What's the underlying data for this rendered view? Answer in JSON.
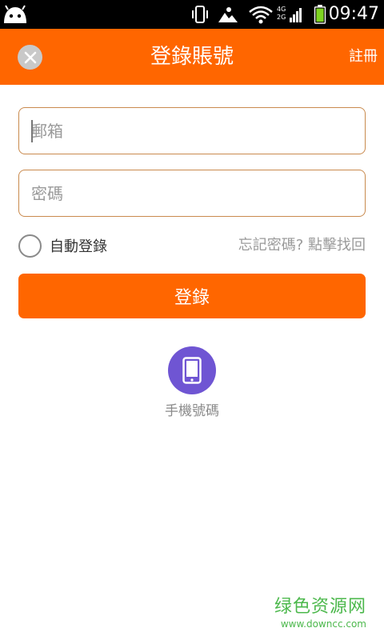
{
  "status_bar": {
    "time": "09:47",
    "network_top": "4G",
    "network_bottom": "2G"
  },
  "header": {
    "title": "登錄賬號",
    "register_label": "註冊"
  },
  "form": {
    "email_placeholder": "郵箱",
    "password_placeholder": "密碼",
    "auto_login_label": "自動登錄",
    "forgot_password_label": "忘記密碼? 點擊找回",
    "login_button_label": "登錄"
  },
  "alt_login": {
    "phone_label": "手機號碼"
  },
  "watermark": {
    "text": "绿色资源网",
    "url": "www.downcc.com"
  },
  "colors": {
    "accent": "#ff6600",
    "phone_icon_bg": "#6f55d3",
    "field_border": "#c98a4e",
    "watermark": "#4cb84c"
  },
  "icons": {
    "close": "close-icon",
    "phone": "mobile-phone-icon",
    "android": "android-icon",
    "vibrate": "vibrate-icon",
    "image": "image-icon",
    "wifi": "wifi-icon",
    "signal": "signal-icon",
    "battery": "battery-icon"
  }
}
